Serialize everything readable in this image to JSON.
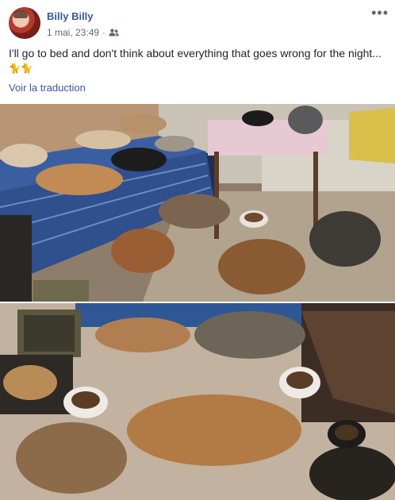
{
  "post": {
    "author": "Billy Billy",
    "timestamp": "1 mai, 23:49",
    "meta_separator": "·",
    "privacy_icon": "friends-icon",
    "more_label": "•••",
    "text": "I'll go to bed and don't think about everything that goes wrong for the night...",
    "emojis": [
      "🐈",
      "🐈"
    ],
    "translate_label": "Voir la traduction"
  },
  "photos": [
    {
      "icon": "photo-dogs-on-bed"
    },
    {
      "icon": "photo-dogs-on-floor"
    }
  ],
  "colors": {
    "link": "#385898",
    "text": "#1d2129",
    "meta": "#616770"
  }
}
